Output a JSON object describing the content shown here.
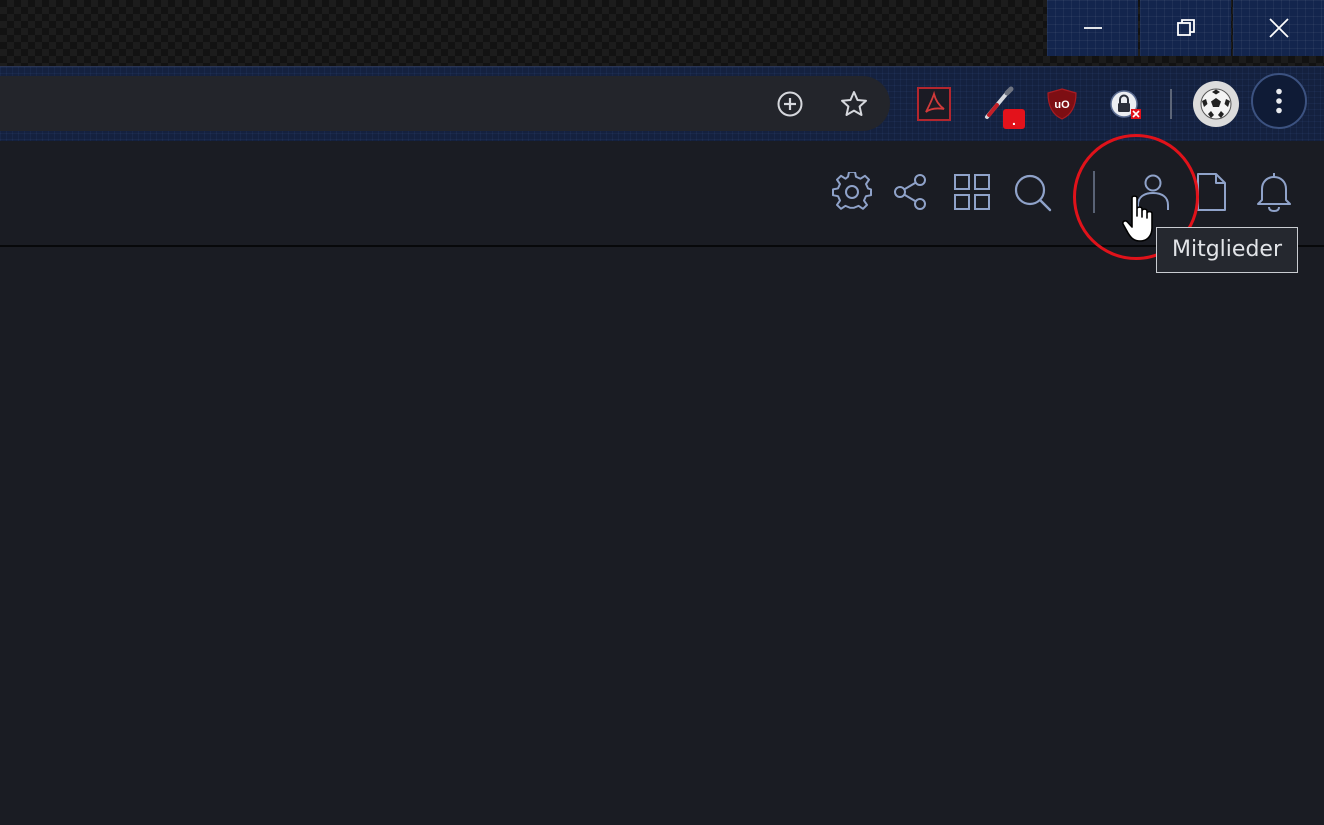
{
  "window": {
    "controls": [
      {
        "icon": "minimize-icon"
      },
      {
        "icon": "restore-icon"
      },
      {
        "icon": "close-icon"
      }
    ]
  },
  "toolbar": {
    "omnibox_actions": [
      "zoom-in-icon",
      "bookmark-star-icon"
    ],
    "extensions": [
      {
        "name": "adobe-acrobat-icon"
      },
      {
        "name": "color-picker-icon",
        "badge": "."
      },
      {
        "name": "ublock-origin-icon",
        "text": "uO"
      },
      {
        "name": "lock-blocked-icon"
      }
    ],
    "profile_icon": "soccer-ball-avatar-icon",
    "menu_icon": "kebab-menu-icon"
  },
  "header": {
    "icons": [
      "gear-icon",
      "share-icon",
      "grid-icon",
      "search-icon",
      "user-icon",
      "document-icon",
      "bell-icon"
    ],
    "icon_color": "#8fa2c9"
  },
  "tooltip": {
    "text": "Mitglieder"
  },
  "colors": {
    "page_bg": "#1a1c23",
    "highlight": "#e0121a"
  }
}
